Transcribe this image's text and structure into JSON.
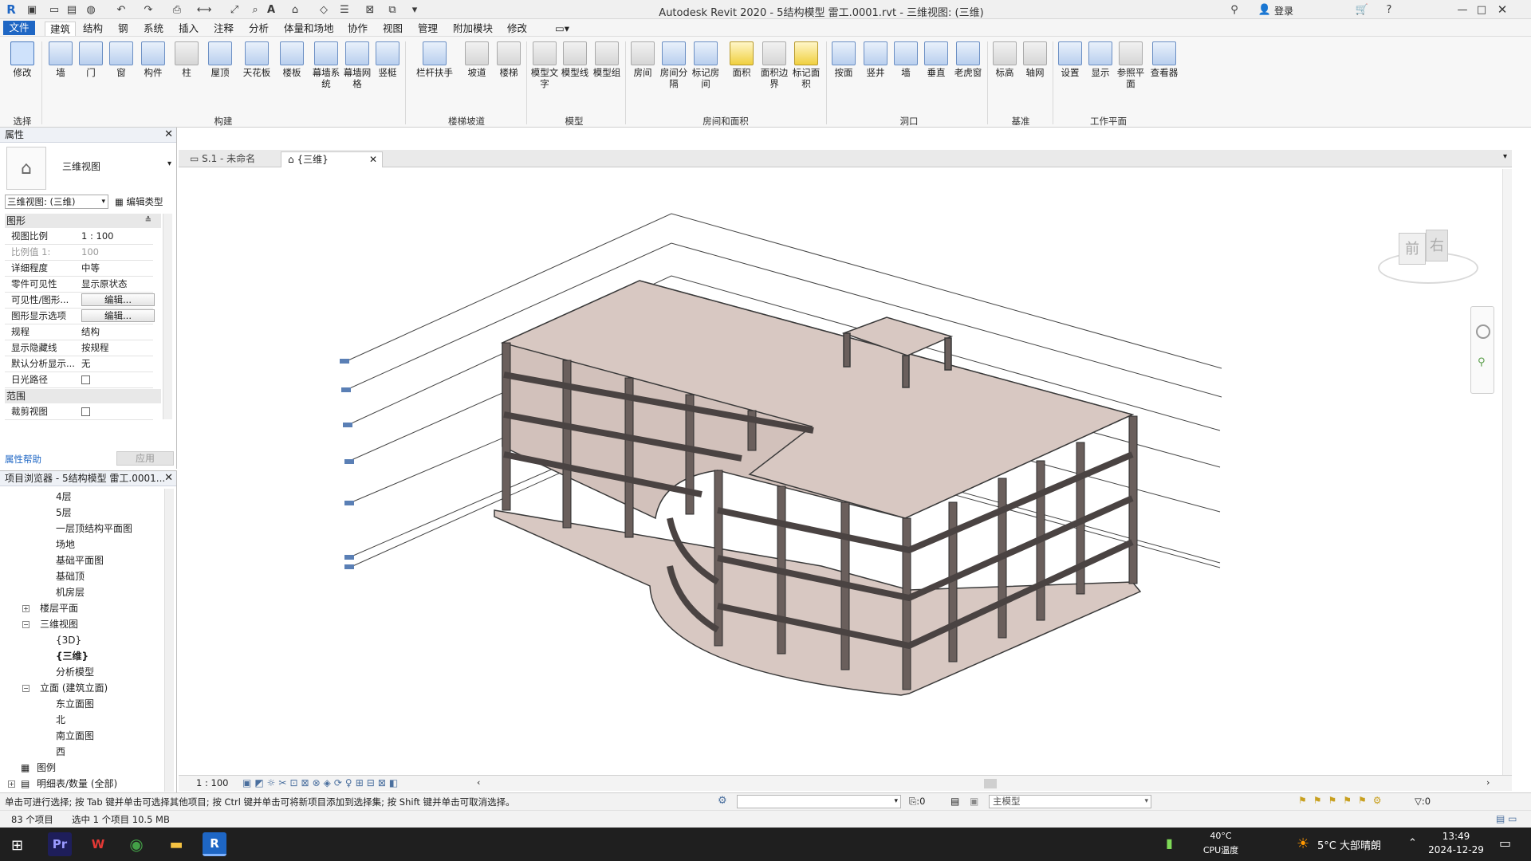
{
  "app": {
    "title": "Autodesk Revit 2020 - 5结构模型 雷工.0001.rvt - 三维视图: (三维)",
    "login": "登录"
  },
  "menu": [
    "文件",
    "建筑",
    "结构",
    "钢",
    "系统",
    "插入",
    "注释",
    "分析",
    "体量和场地",
    "协作",
    "视图",
    "管理",
    "附加模块",
    "修改"
  ],
  "ribbon": {
    "buttons": [
      "修改",
      "墙",
      "门",
      "窗",
      "构件",
      "柱",
      "屋顶",
      "天花板",
      "楼板",
      "幕墙系统",
      "幕墙网格",
      "竖梃",
      "栏杆扶手",
      "坡道",
      "楼梯",
      "模型文字",
      "模型线",
      "模型组",
      "房间",
      "房间分隔",
      "标记房间",
      "面积",
      "面积边界",
      "标记面积",
      "按面",
      "竖井",
      "墙",
      "垂直",
      "老虎窗",
      "标高",
      "轴网",
      "设置",
      "显示",
      "参照平面",
      "查看器"
    ],
    "panels": [
      "选择",
      "构建",
      "楼梯坡道",
      "模型",
      "房间和面积",
      "洞口",
      "基准",
      "工作平面"
    ]
  },
  "properties": {
    "header": "属性",
    "type_name": "三维视图",
    "instance_select": "三维视图: (三维)",
    "edit_type": "编辑类型",
    "group_graphics": "图形",
    "rows": [
      {
        "k": "视图比例",
        "v": "1 : 100"
      },
      {
        "k": "比例值 1:",
        "v": "100"
      },
      {
        "k": "详细程度",
        "v": "中等"
      },
      {
        "k": "零件可见性",
        "v": "显示原状态"
      },
      {
        "k": "可见性/图形...",
        "v": "编辑..."
      },
      {
        "k": "图形显示选项",
        "v": "编辑..."
      },
      {
        "k": "规程",
        "v": "结构"
      },
      {
        "k": "显示隐藏线",
        "v": "按规程"
      },
      {
        "k": "默认分析显示...",
        "v": "无"
      },
      {
        "k": "日光路径",
        "v": ""
      }
    ],
    "group_extents": "范围",
    "crop_view": "裁剪视图",
    "help": "属性帮助",
    "apply": "应用"
  },
  "browser": {
    "header": "项目浏览器 - 5结构模型 雷工.0001...",
    "items": [
      "4层",
      "5层",
      "一层顶结构平面图",
      "场地",
      "基础平面图",
      "基础顶",
      "机房层",
      "楼层平面",
      "三维视图",
      "{3D}",
      "{三维}",
      "分析模型",
      "立面 (建筑立面)",
      "东立面图",
      "北",
      "南立面图",
      "西",
      "图例",
      "明细表/数量 (全部)"
    ]
  },
  "views": {
    "tab1": "S.1 - 未命名",
    "tab2": "{三维}"
  },
  "viewcube": {
    "front": "前",
    "right": "右"
  },
  "viewctrl": {
    "scale": "1 : 100"
  },
  "status": {
    "hint": "单击可进行选择; 按 Tab 键并单击可选择其他项目; 按 Ctrl 键并单击可将新项目添加到选择集; 按 Shift 键并单击可取消选择。",
    "count": "83 个项目",
    "selected": "选中 1 个项目  10.5 MB",
    "zero1": ":0",
    "main_model": "主模型",
    "filter": ":0"
  },
  "taskbar": {
    "cpu_temp": "40°C",
    "cpu_label": "CPU温度",
    "weather": "5°C  大部晴朗",
    "time": "13:49",
    "date": "2024-12-29"
  }
}
